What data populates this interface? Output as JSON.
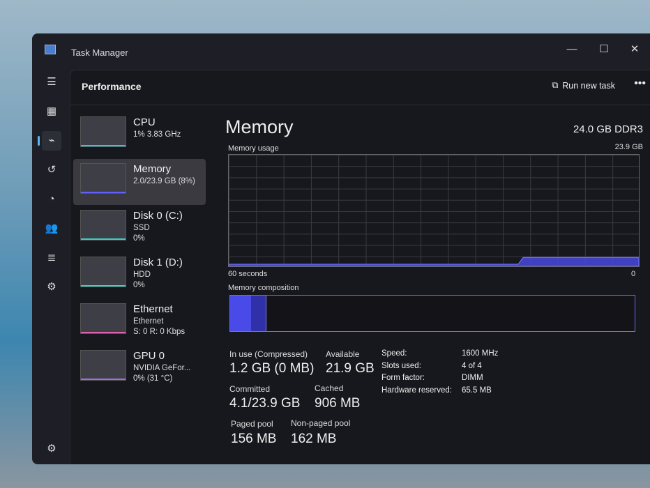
{
  "window": {
    "title": "Task Manager",
    "minimize": "—",
    "maximize": "☐",
    "close": "✕"
  },
  "nav": {
    "icons": [
      "menu-icon",
      "processes-icon",
      "performance-icon",
      "app-history-icon",
      "startup-icon",
      "users-icon",
      "details-icon",
      "services-icon",
      "settings-icon"
    ]
  },
  "header": {
    "title": "Performance",
    "run_new_task": "Run new task",
    "more": "•••"
  },
  "resources": [
    {
      "name": "CPU",
      "line1": "1% 3.83 GHz",
      "line2": "",
      "color": "#35c4e0"
    },
    {
      "name": "Memory",
      "line1": "2.0/23.9 GB (8%)",
      "line2": "",
      "color": "#6060ff"
    },
    {
      "name": "Disk 0 (C:)",
      "line1": "SSD",
      "line2": "0%",
      "color": "#3cd0c0"
    },
    {
      "name": "Disk 1 (D:)",
      "line1": "HDD",
      "line2": "0%",
      "color": "#3cd0c0"
    },
    {
      "name": "Ethernet",
      "line1": "Ethernet",
      "line2": "S: 0 R: 0 Kbps",
      "color": "#e060b0"
    },
    {
      "name": "GPU 0",
      "line1": "NVIDIA GeFor...",
      "line2": "0% (31 °C)",
      "color": "#a070e0"
    }
  ],
  "main": {
    "title": "Memory",
    "spec": "24.0 GB DDR3",
    "usage_label": "Memory usage",
    "usage_max": "23.9 GB",
    "time_left": "60 seconds",
    "time_right": "0",
    "usage_percent": 8,
    "composition_label": "Memory composition",
    "stats": {
      "in_use_label": "In use (Compressed)",
      "in_use": "1.2 GB (0 MB)",
      "available_label": "Available",
      "available": "21.9 GB",
      "committed_label": "Committed",
      "committed": "4.1/23.9 GB",
      "cached_label": "Cached",
      "cached": "906 MB",
      "paged_label": "Paged pool",
      "paged": "156 MB",
      "nonpaged_label": "Non-paged pool",
      "nonpaged": "162 MB"
    },
    "specs": [
      {
        "k": "Speed:",
        "v": "1600 MHz"
      },
      {
        "k": "Slots used:",
        "v": "4 of 4"
      },
      {
        "k": "Form factor:",
        "v": "DIMM"
      },
      {
        "k": "Hardware reserved:",
        "v": "65.5 MB"
      }
    ]
  }
}
